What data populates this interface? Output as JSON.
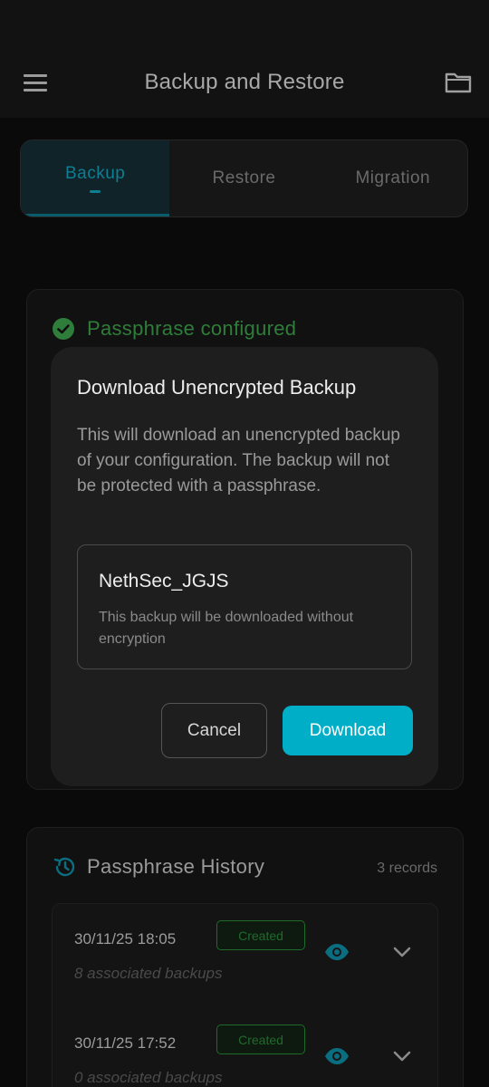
{
  "app": {
    "title": "Backup and Restore"
  },
  "tabs": [
    {
      "label": "Backup",
      "active": true
    },
    {
      "label": "Restore",
      "active": false
    },
    {
      "label": "Migration",
      "active": false
    }
  ],
  "passphrase_card": {
    "status": "Passphrase configured"
  },
  "modal": {
    "title": "Download Unencrypted Backup",
    "description": "This will download an unencrypted backup of your configuration. The backup will not be protected with a passphrase.",
    "backup_name": "NethSec_JGJS",
    "backup_note": "This backup will be downloaded without encryption",
    "cancel_label": "Cancel",
    "download_label": "Download"
  },
  "history": {
    "title": "Passphrase History",
    "count": "3 records",
    "rows": [
      {
        "date": "30/11/25 18:05",
        "badge": "Created",
        "associated": "8 associated backups"
      },
      {
        "date": "30/11/25 17:52",
        "badge": "Created",
        "associated": "0 associated backups"
      }
    ]
  },
  "colors": {
    "accent": "#00aec7",
    "success": "#2f7d3a",
    "background": "#0a0a0a"
  }
}
